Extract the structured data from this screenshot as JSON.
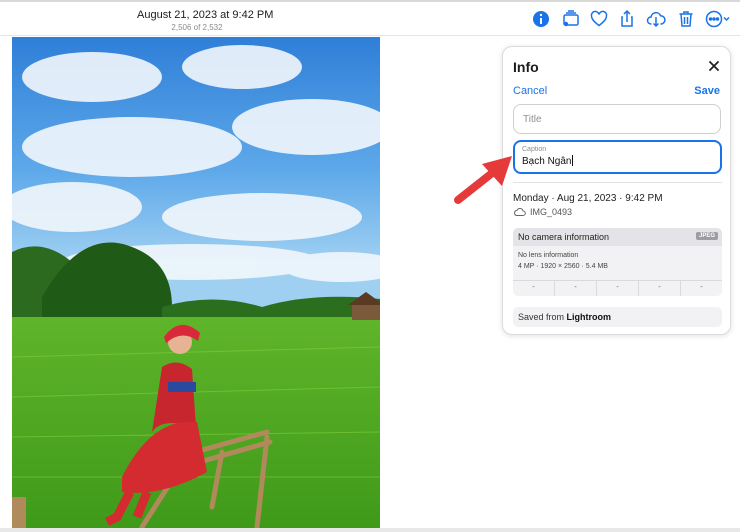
{
  "toolbar": {
    "date": "August 21, 2023 at 9:42 PM",
    "count": "2,506 of 2,532",
    "icons": [
      "info-icon",
      "slideshow-icon",
      "heart-icon",
      "share-icon",
      "download-icon",
      "trash-icon",
      "more-icon"
    ],
    "accent": "#1a73e8"
  },
  "info_panel": {
    "title": "Info",
    "cancel": "Cancel",
    "save": "Save",
    "title_placeholder": "Title",
    "caption_label": "Caption",
    "caption_value": "Bạch Ngân",
    "date": "Monday · Aug 21, 2023 · 9:42 PM",
    "filename": "IMG_0493",
    "camera": "No camera information",
    "format": "JPEG",
    "lens": "No lens information",
    "specs": "4 MP · 1920 × 2560 · 5.4 MB",
    "metrics": [
      "-",
      "-",
      "-",
      "-",
      "-"
    ],
    "saved_prefix": "Saved from",
    "saved_app": "Lightroom"
  },
  "annotation": {
    "arrow_color": "#e63a3a"
  }
}
